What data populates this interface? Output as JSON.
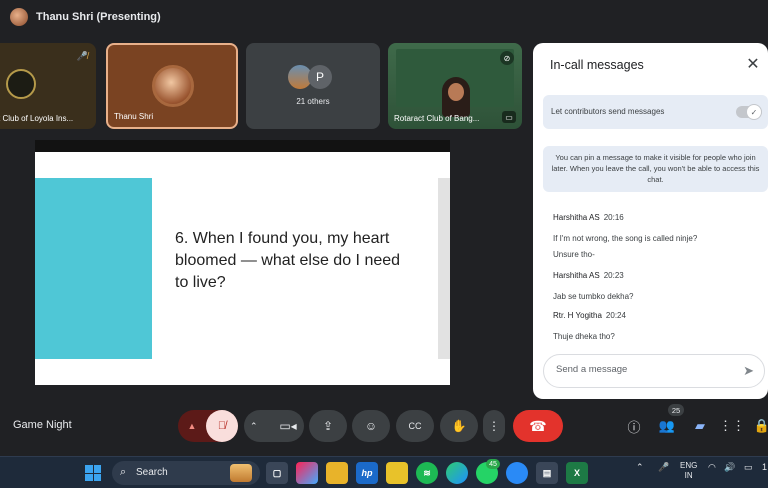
{
  "header": {
    "title": "Thanu Shri (Presenting)"
  },
  "tiles": {
    "t1": {
      "name": "t Club of Loyola Ins..."
    },
    "t2": {
      "name": "Thanu Shri"
    },
    "t3": {
      "avatar_letter": "P",
      "label": "21 others"
    },
    "t4": {
      "name": "Rotaract Club of Bang..."
    }
  },
  "slide": {
    "text": "6. When I found you, my heart bloomed — what else do I need to live?"
  },
  "panel": {
    "title": "In-call messages",
    "toggle_label": "Let contributors send messages",
    "toggle_on": true,
    "info": "You can pin a message to make it visible for people who join later. When you leave the call, you won't be able to access this chat.",
    "messages": [
      {
        "sender": "Harshitha AS",
        "time": "20:16",
        "lines": [
          "If I'm not wrong, the song is called ninje?",
          "Unsure tho-"
        ]
      },
      {
        "sender": "Harshitha AS",
        "time": "20:23",
        "lines": [
          "Jab se tumbko dekha?"
        ]
      },
      {
        "sender": "Rtr. H Yogitha",
        "time": "20:24",
        "lines": [
          "Thuje dheka tho?"
        ]
      }
    ],
    "compose_placeholder": "Send a message"
  },
  "controls": {
    "meeting_name": "Game Night",
    "people_count": "25"
  },
  "taskbar": {
    "search_label": "Search",
    "whatsapp_badge": "45",
    "lang_line1": "ENG",
    "lang_line2": "IN",
    "clock_partial": "1"
  },
  "colors": {
    "end_call": "#e3332c",
    "teal_block": "#4fc7d6",
    "panel_bg": "#ffffff"
  }
}
